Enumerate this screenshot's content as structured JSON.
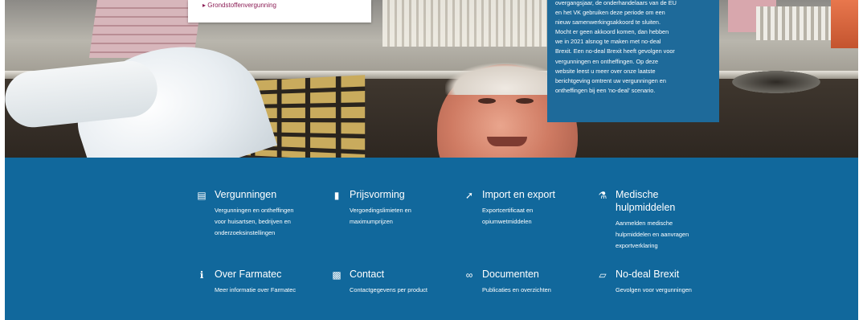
{
  "hero": {
    "submenu_link": "▸ Grondstoffenvergunning",
    "notice_lines": [
      "overgangsjaar, de onderhandelaars van de EU",
      "en het VK gebruiken deze periode om een",
      "nieuw samenwerkingsakkoord te sluiten.",
      "Mocht er geen akkoord komen, dan hebben",
      "we in 2021 alsnog te maken met no-deal",
      "Brexit. Een no-deal Brexit heeft gevolgen voor",
      "vergunningen en ontheffingen. Op deze",
      "website leest u meer over onze laatste",
      "berichtgeving omtrent uw vergunningen en",
      "ontheffingen bij een 'no-deal' scenario."
    ]
  },
  "nav": [
    {
      "icon": "document-icon",
      "title": "Vergunningen",
      "desc": [
        "Vergunningen en ontheffingen",
        "voor huisartsen, bedrijven en",
        "onderzoeksinstellingen"
      ]
    },
    {
      "icon": "jar-icon",
      "title": "Prijsvorming",
      "desc": [
        "Vergoedingslimieten en",
        "maximumprijzen"
      ]
    },
    {
      "icon": "export-icon",
      "title": "Import en export",
      "desc": [
        "Exportcertificaat en",
        "opiumwetmiddelen"
      ]
    },
    {
      "icon": "medical-aid-icon",
      "title": "Medische hulpmiddelen",
      "desc": [
        "Aanmelden medische",
        "hulpmiddelen en aanvragen",
        "exportverklaring"
      ]
    },
    {
      "icon": "info-icon",
      "title": "Over Farmatec",
      "desc": [
        "Meer informatie over Farmatec"
      ]
    },
    {
      "icon": "chat-icon",
      "title": "Contact",
      "desc": [
        "Contactgegevens per product"
      ]
    },
    {
      "icon": "documents-icon",
      "title": "Documenten",
      "desc": [
        "Publicaties en overzichten"
      ]
    },
    {
      "icon": "bottle-icon",
      "title": "No-deal Brexit",
      "desc": [
        "Gevolgen voor vergunningen"
      ]
    }
  ],
  "colors": {
    "band": "#11689c",
    "notice": "#1e6a9a",
    "link": "#8c1e56"
  }
}
